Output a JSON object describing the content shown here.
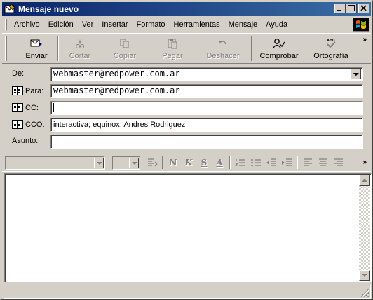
{
  "window": {
    "title": "Mensaje nuevo"
  },
  "menubar": {
    "items": [
      "Archivo",
      "Edición",
      "Ver",
      "Insertar",
      "Formato",
      "Herramientas",
      "Mensaje",
      "Ayuda"
    ]
  },
  "toolbar": {
    "items": [
      {
        "label": "Enviar",
        "icon": "send-icon",
        "enabled": true
      },
      {
        "label": "Cortar",
        "icon": "scissors-icon",
        "enabled": false
      },
      {
        "label": "Copiar",
        "icon": "copy-icon",
        "enabled": false
      },
      {
        "label": "Pegar",
        "icon": "paste-icon",
        "enabled": false
      },
      {
        "label": "Deshacer",
        "icon": "undo-icon",
        "enabled": false
      },
      {
        "label": "Comprobar",
        "icon": "check-names-icon",
        "enabled": true
      },
      {
        "label": "Ortografía",
        "icon": "spelling-icon",
        "enabled": true
      }
    ],
    "overflow": "»"
  },
  "header": {
    "from_label": "De:",
    "from_value": "webmaster@redpower.com.ar",
    "to_label": "Para:",
    "to_value": "webmaster@redpower.com.ar",
    "cc_label": "CC:",
    "cc_value": "",
    "bcc_label": "CCO:",
    "bcc_recipients": [
      "interactiva",
      "equinox",
      "Andres Rodriguez"
    ],
    "bcc_separator": "; ",
    "subject_label": "Asunto:",
    "subject_value": ""
  },
  "format_bar": {
    "font_value": "",
    "size_value": "",
    "buttons": [
      "paragraph-style",
      "bold",
      "italic",
      "underline",
      "font-color",
      "numbered-list",
      "bulleted-list",
      "decrease-indent",
      "increase-indent",
      "align-left",
      "align-center",
      "align-right"
    ],
    "bold_glyph": "N",
    "italic_glyph": "K",
    "underline_glyph": "S",
    "color_glyph": "A",
    "overflow": "»"
  },
  "colors": {
    "titlebar_start": "#0a246a",
    "titlebar_end": "#3a6ea5",
    "face": "#d4d0c8"
  }
}
